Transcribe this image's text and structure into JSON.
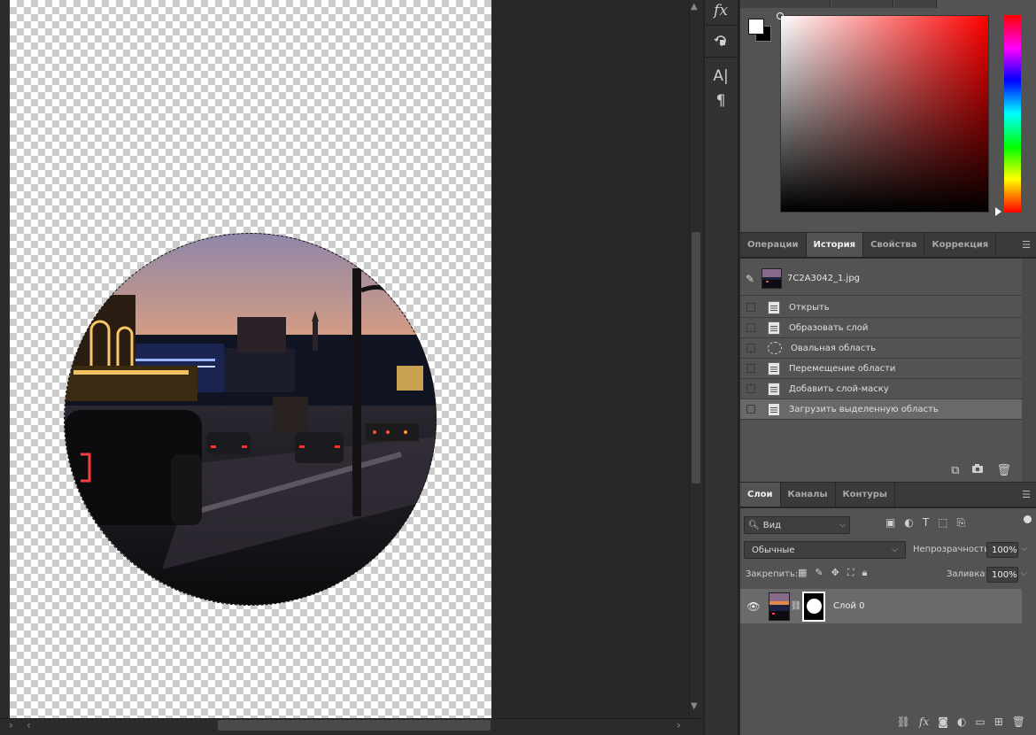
{
  "history_panel": {
    "tabs": [
      "Операции",
      "История",
      "Свойства",
      "Коррекция"
    ],
    "snapshot_name": "7C2A3042_1.jpg",
    "steps": [
      {
        "label": "Открыть",
        "icon": "document-icon",
        "active": false
      },
      {
        "label": "Образовать слой",
        "icon": "document-icon",
        "active": false
      },
      {
        "label": "Овальная область",
        "icon": "oval-marquee-icon",
        "active": false
      },
      {
        "label": "Перемещение области",
        "icon": "document-icon",
        "active": false
      },
      {
        "label": "Добавить слой-маску",
        "icon": "document-icon",
        "active": false
      },
      {
        "label": "Загрузить выделенную область",
        "icon": "document-icon",
        "active": true
      }
    ]
  },
  "layers_panel": {
    "tabs": [
      "Слои",
      "Каналы",
      "Контуры"
    ],
    "filter_label": "Вид",
    "blend_mode": "Обычные",
    "opacity_label": "Непрозрачность:",
    "opacity_value": "100%",
    "lock_label": "Закрепить:",
    "fill_label": "Заливка:",
    "fill_value": "100%",
    "layers": [
      {
        "name": "Слой 0",
        "visible": true,
        "has_mask": true
      }
    ]
  },
  "tool_strip": {
    "icons": [
      "fx-icon",
      "history-brush-icon",
      "character-icon",
      "paragraph-icon"
    ]
  },
  "colors": {
    "panel_bg": "#535353",
    "active_row": "#696969",
    "app_bg": "#282828",
    "foreground": "#ffffff",
    "background": "#000000",
    "hue": "#ff0000"
  }
}
